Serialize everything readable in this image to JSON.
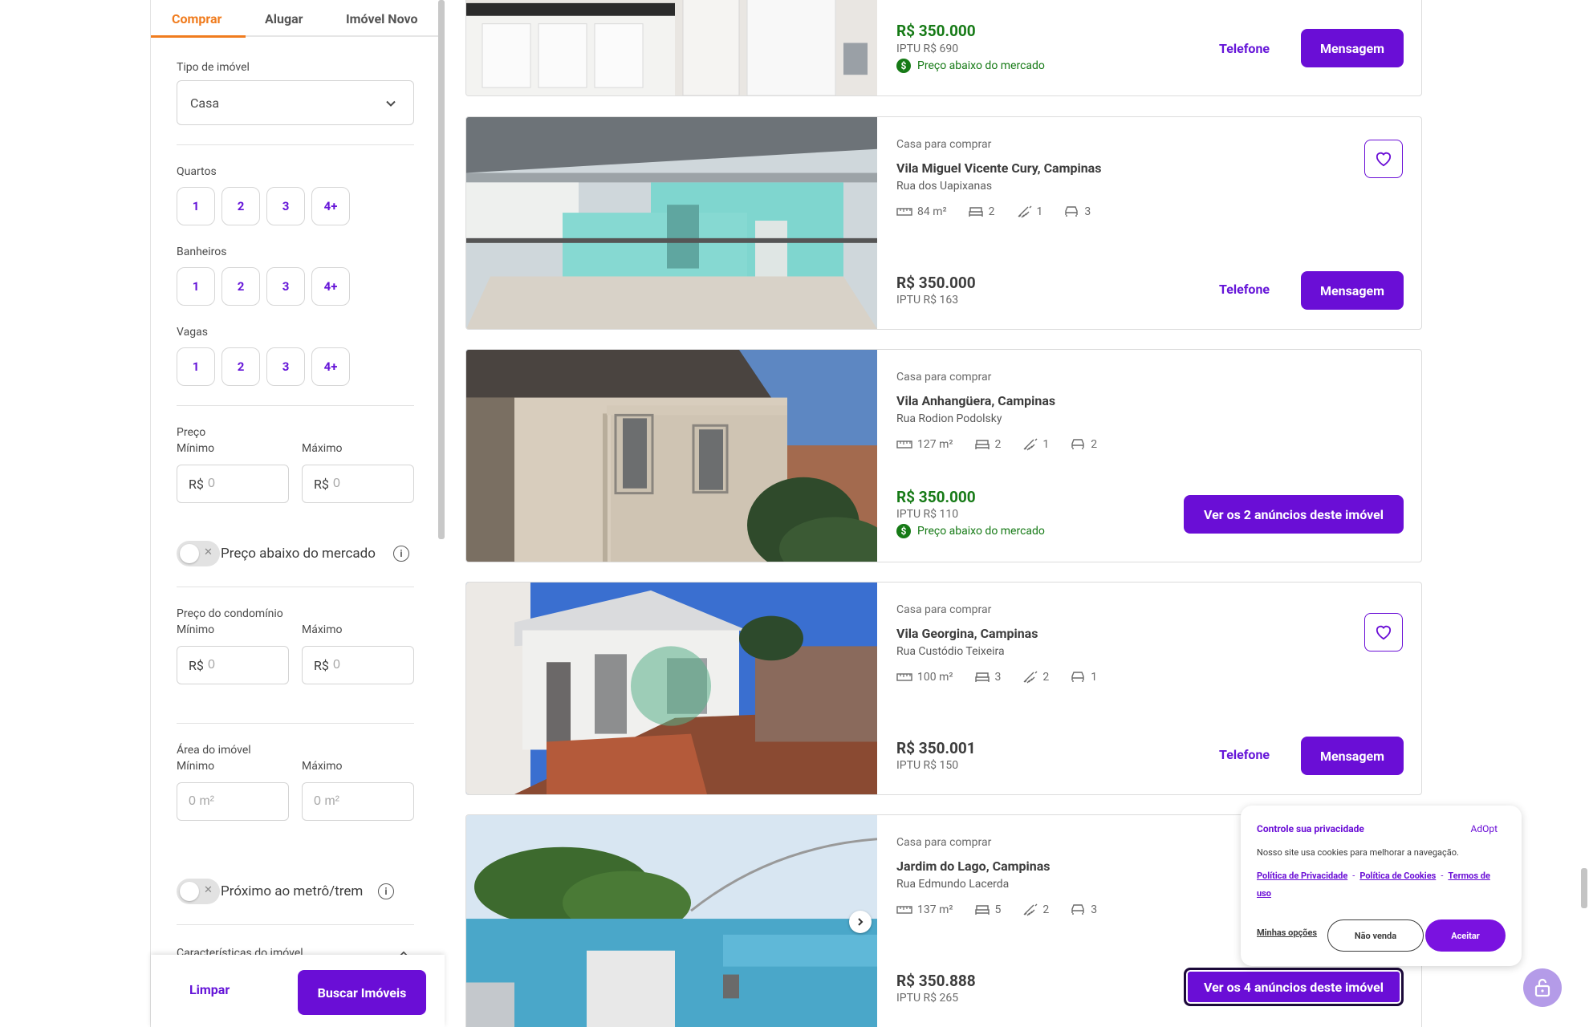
{
  "tabs": [
    "Comprar",
    "Alugar",
    "Imóvel Novo"
  ],
  "filters": {
    "tipo_label": "Tipo de imóvel",
    "tipo_value": "Casa",
    "quartos_label": "Quartos",
    "banheiros_label": "Banheiros",
    "vagas_label": "Vagas",
    "options": [
      "1",
      "2",
      "3",
      "4+"
    ],
    "preco_label": "Preço",
    "minimo": "Mínimo",
    "maximo": "Máximo",
    "currency": "R$",
    "zero": "0",
    "preco_abaixo_label": "Preço abaixo do mercado",
    "condominio_label": "Preço do condomínio",
    "area_label": "Área do imóvel",
    "area_placeholder": "0 m²",
    "metro_label": "Próximo ao metrô/trem",
    "caracteristicas_label": "Características do imóvel"
  },
  "footer": {
    "limpar": "Limpar",
    "buscar": "Buscar Imóveis"
  },
  "listings": [
    {
      "price": "R$ 350.000",
      "iptu": "IPTU R$ 690",
      "below_market": "Preço abaixo do mercado",
      "telefone": "Telefone",
      "mensagem": "Mensagem"
    },
    {
      "type": "Casa para comprar",
      "name": "Vila Miguel Vicente Cury, Campinas",
      "street": "Rua dos Uapixanas",
      "area": "84 m²",
      "beds": "2",
      "baths": "1",
      "parking": "3",
      "price": "R$ 350.000",
      "iptu": "IPTU R$ 163",
      "telefone": "Telefone",
      "mensagem": "Mensagem"
    },
    {
      "type": "Casa para comprar",
      "name": "Vila Anhangüera, Campinas",
      "street": "Rua Rodion Podolsky",
      "area": "127 m²",
      "beds": "2",
      "baths": "1",
      "parking": "2",
      "price": "R$ 350.000",
      "iptu": "IPTU R$ 110",
      "below_market": "Preço abaixo do mercado",
      "ver": "Ver os 2 anúncios deste imóvel"
    },
    {
      "type": "Casa para comprar",
      "name": "Vila Georgina, Campinas",
      "street": "Rua Custódio Teixeira",
      "area": "100 m²",
      "beds": "3",
      "baths": "2",
      "parking": "1",
      "price": "R$ 350.001",
      "iptu": "IPTU R$ 150",
      "telefone": "Telefone",
      "mensagem": "Mensagem"
    },
    {
      "type": "Casa para comprar",
      "name": "Jardim do Lago, Campinas",
      "street": "Rua Edmundo Lacerda",
      "area": "137 m²",
      "beds": "5",
      "baths": "2",
      "parking": "3",
      "price": "R$ 350.888",
      "iptu": "IPTU R$ 265",
      "ver": "Ver os 4 anúncios deste imóvel"
    }
  ],
  "privacy": {
    "title": "Controle sua privacidade",
    "brand": "AdOpt",
    "text": "Nosso site usa cookies para melhorar a navegação.",
    "link_privacidade": "Política de Privacidade",
    "link_cookies": "Política de Cookies",
    "link_termos": "Termos de uso",
    "opcoes": "Minhas opções",
    "nao_venda": "Não venda",
    "aceitar": "Aceitar"
  },
  "colors": {
    "accent": "#6a0ed6",
    "tab_active": "#f07c1e",
    "green": "#167a16"
  },
  "icons": [
    "chevron-down-icon",
    "info-icon",
    "ruler-icon",
    "bed-icon",
    "shower-icon",
    "car-icon",
    "dollar-icon",
    "heart-icon",
    "chevron-right-icon",
    "lock-icon"
  ]
}
